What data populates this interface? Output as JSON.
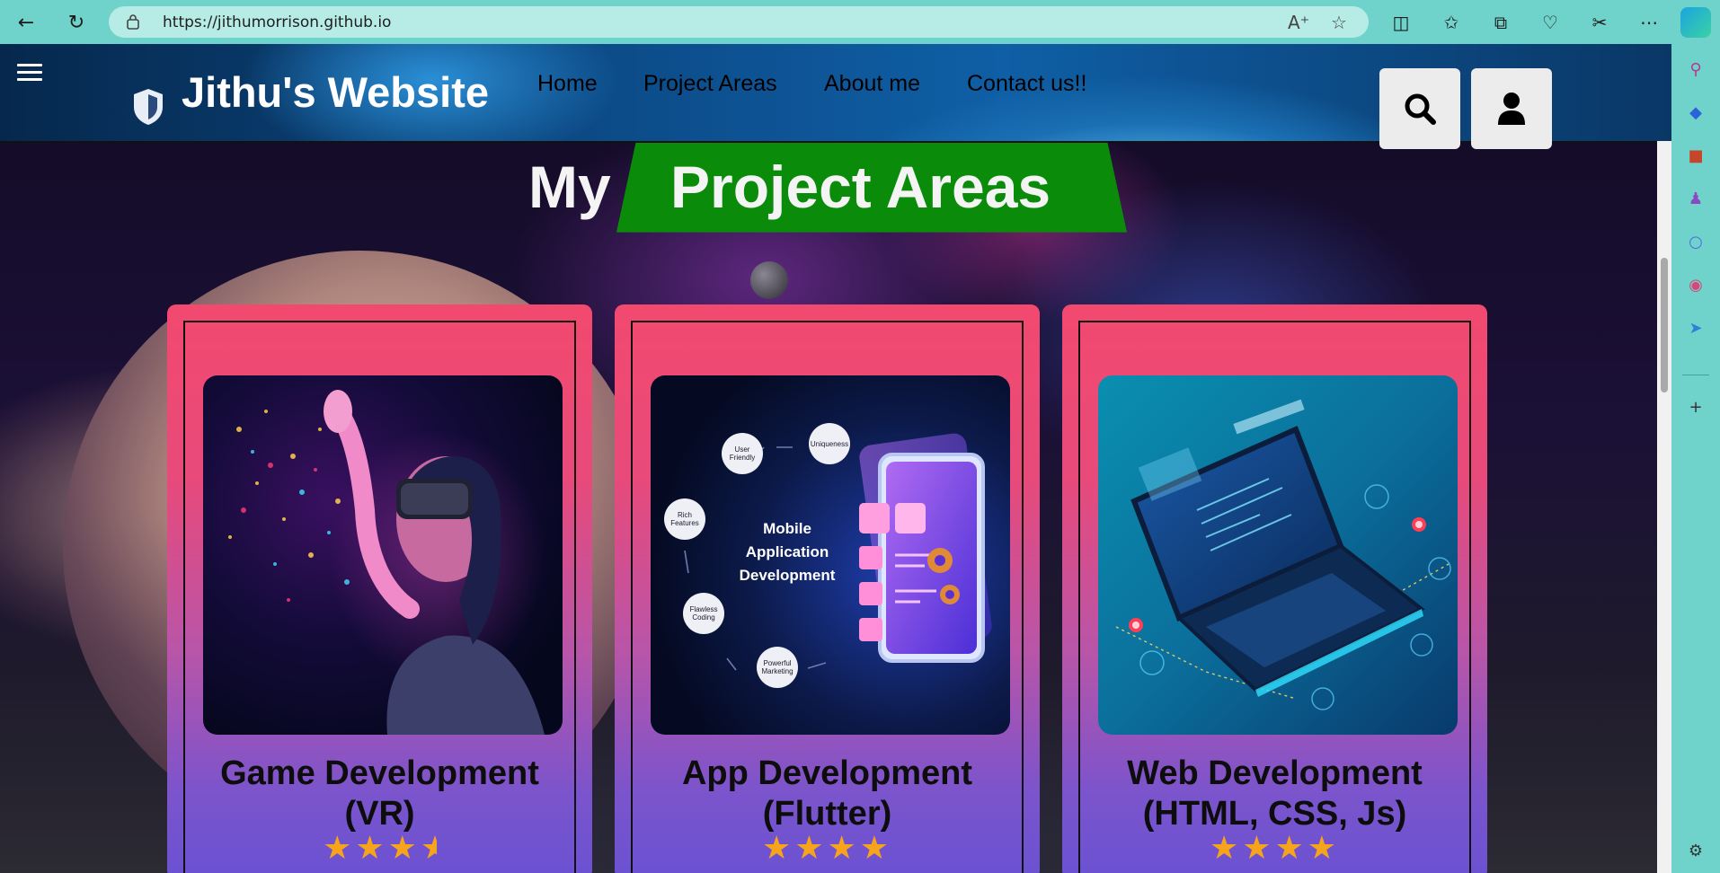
{
  "browser": {
    "url": "https://jithumorrison.github.io"
  },
  "site": {
    "title": "Jithu's Website",
    "nav": [
      "Home",
      "Project Areas",
      "About me",
      "Contact us!!"
    ]
  },
  "section": {
    "title_prefix": "My",
    "title_highlight": "Project Areas"
  },
  "app_mockup": {
    "center_text": "Mobile Application Development",
    "features": [
      "User Friendly",
      "Uniqueness",
      "Rich Features",
      "Flawless Coding",
      "Powerful Marketing"
    ]
  },
  "cards": [
    {
      "title_line1": "Game Development",
      "title_line2": "(VR)",
      "rating": 3.5
    },
    {
      "title_line1": "App Development",
      "title_line2": "(Flutter)",
      "rating": 4
    },
    {
      "title_line1": "Web Development",
      "title_line2": "(HTML, CSS, Js)",
      "rating": 4
    }
  ],
  "icons": {
    "back": "back-arrow-icon",
    "refresh": "refresh-icon",
    "search": "search-icon",
    "user": "user-icon",
    "menu": "hamburger-icon",
    "logo": "shield-icon"
  },
  "colors": {
    "card_top": "#f2496f",
    "card_bottom": "#6a52d2",
    "ribbon": "#0a8c0a",
    "star": "#f5a41c",
    "browser_chrome": "#6fd3cb"
  }
}
